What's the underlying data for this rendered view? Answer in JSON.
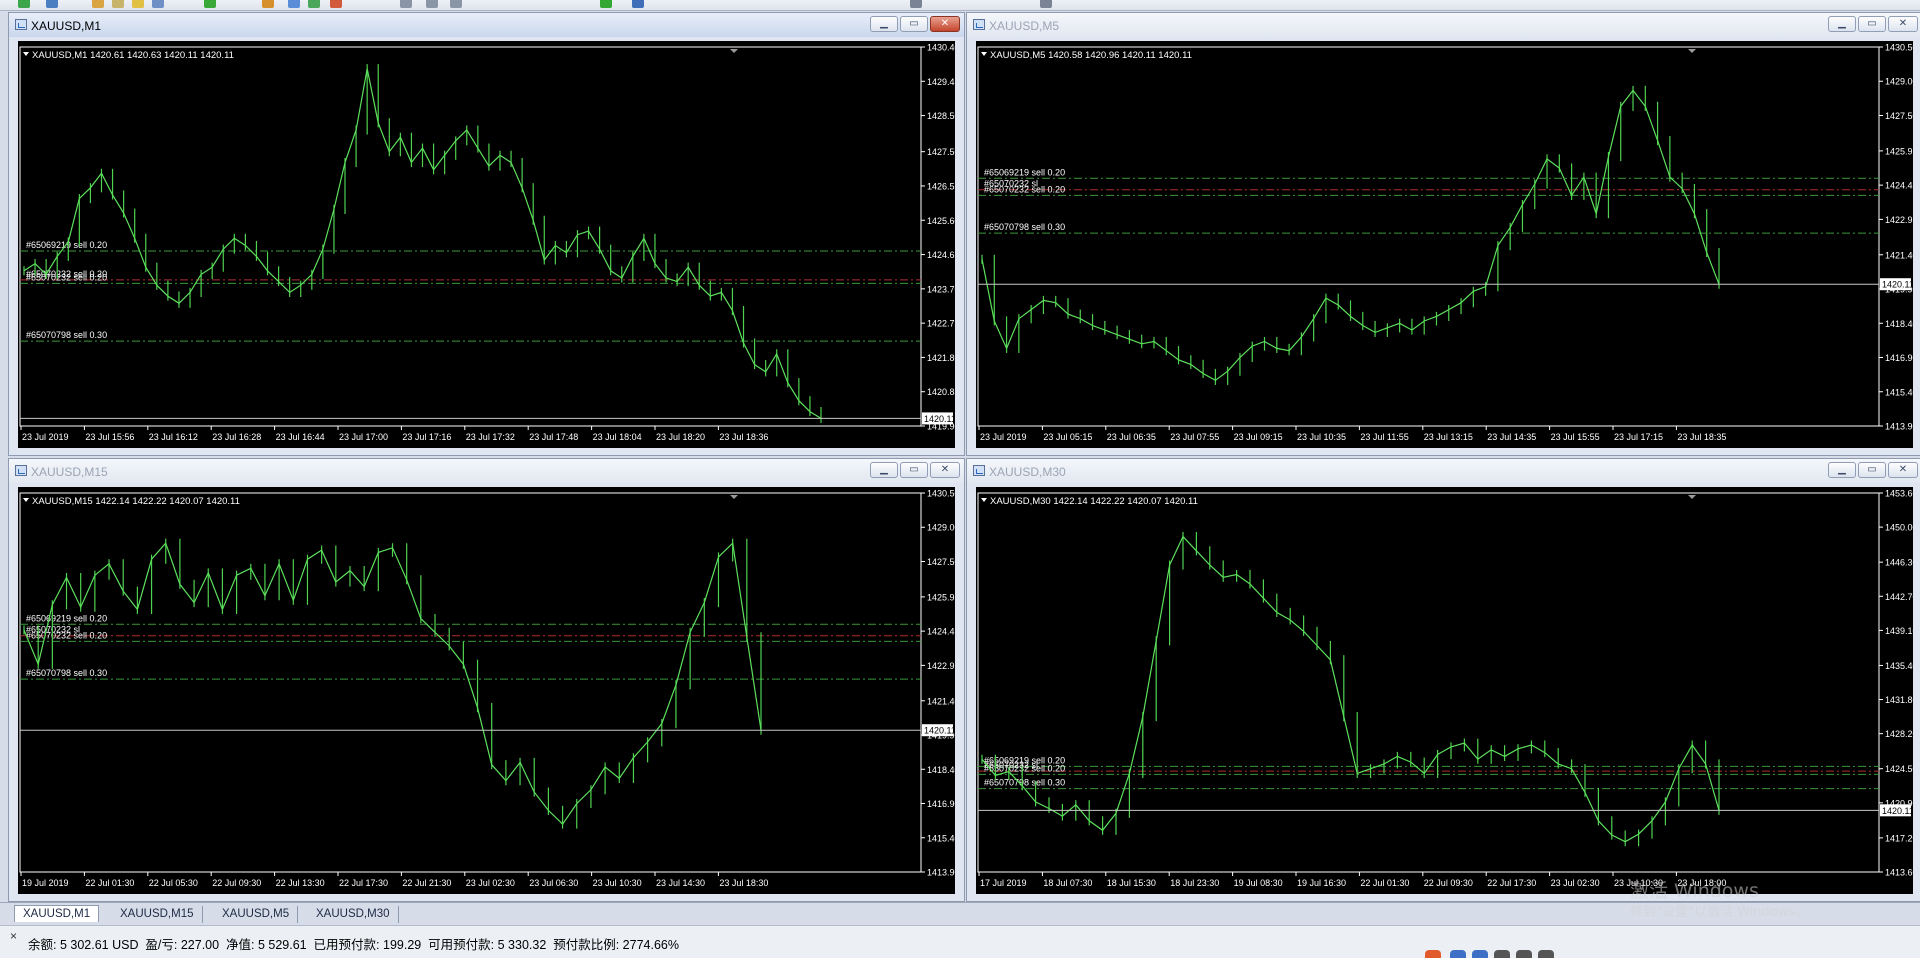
{
  "toolbar": {
    "icons": [
      "new-chart-icon",
      "profiles-icon",
      "refresh-icon",
      "folder-icon",
      "star-icon",
      "market-watch-icon",
      "add-icon",
      "expert-icon",
      "autotrading-icon",
      "bar-chart-icon",
      "candles-icon",
      "line-chart-icon",
      "zoom-in-icon",
      "zoom-out-icon",
      "add-order-icon",
      "globe-icon",
      "crosshair-icon",
      "cursor-icon"
    ]
  },
  "windows": [
    {
      "id": "m1",
      "title": "XAUUSD,M1",
      "info": "XAUUSD,M1  1420.61 1420.63 1420.11 1420.11",
      "active": true,
      "y_range": [
        1419.9,
        1430.4
      ],
      "price_labels": [
        "1430.40",
        "1429.45",
        "1428.50",
        "1427.50",
        "1426.55",
        "1425.60",
        "1424.65",
        "1423.70",
        "1422.75",
        "1421.80",
        "1420.85",
        "1419.90"
      ],
      "current_price": "1420.11",
      "current_price_value": 1420.11,
      "time_labels": [
        "23 Jul 2019",
        "23 Jul 15:56",
        "23 Jul 16:12",
        "23 Jul 16:28",
        "23 Jul 16:44",
        "23 Jul 17:00",
        "23 Jul 17:16",
        "23 Jul 17:32",
        "23 Jul 17:48",
        "23 Jul 18:04",
        "23 Jul 18:20",
        "23 Jul 18:36"
      ],
      "orders": [
        {
          "label": "#65069219 sell 0.20",
          "price": 1424.75,
          "color": "#3a9a3a"
        },
        {
          "label": "#65070232 sell 0.20",
          "price": 1423.95,
          "color": "#b03030"
        },
        {
          "label": "#65070232 sell 0.20",
          "price": 1423.85,
          "color": "#3a9a3a"
        },
        {
          "label": "#65070798 sell 0.30",
          "price": 1422.25,
          "color": "#3a9a3a"
        }
      ],
      "series": [
        1424.2,
        1424.4,
        1424.1,
        1424.6,
        1425.0,
        1426.2,
        1426.5,
        1426.9,
        1426.3,
        1425.8,
        1425.1,
        1424.3,
        1423.8,
        1423.5,
        1423.3,
        1423.6,
        1424.1,
        1424.3,
        1424.8,
        1425.1,
        1424.9,
        1424.6,
        1424.2,
        1423.9,
        1423.6,
        1423.8,
        1424.1,
        1424.8,
        1425.9,
        1427.2,
        1428.1,
        1429.8,
        1428.3,
        1427.5,
        1427.9,
        1427.2,
        1427.6,
        1427.0,
        1427.4,
        1427.8,
        1428.1,
        1427.6,
        1427.1,
        1427.4,
        1427.2,
        1426.5,
        1425.6,
        1424.5,
        1424.9,
        1424.7,
        1425.2,
        1425.3,
        1424.8,
        1424.2,
        1424.0,
        1424.6,
        1425.1,
        1424.4,
        1424.0,
        1423.9,
        1424.3,
        1423.8,
        1423.5,
        1423.6,
        1423.1,
        1422.2,
        1421.6,
        1421.4,
        1421.9,
        1421.1,
        1420.6,
        1420.3,
        1420.11
      ]
    },
    {
      "id": "m5",
      "title": "XAUUSD,M5",
      "info": "XAUUSD,M5  1420.58 1420.96 1420.11 1420.11",
      "active": false,
      "y_range": [
        1413.9,
        1430.5
      ],
      "price_labels": [
        "1430.50",
        "1429.00",
        "1427.50",
        "1425.95",
        "1424.45",
        "1422.95",
        "1421.40",
        "1419.90",
        "1418.40",
        "1416.90",
        "1415.40",
        "1413.90"
      ],
      "current_price": "1420.11",
      "current_price_value": 1420.11,
      "time_labels": [
        "23 Jul 2019",
        "23 Jul 05:15",
        "23 Jul 06:35",
        "23 Jul 07:55",
        "23 Jul 09:15",
        "23 Jul 10:35",
        "23 Jul 11:55",
        "23 Jul 13:15",
        "23 Jul 14:35",
        "23 Jul 15:55",
        "23 Jul 17:15",
        "23 Jul 18:35"
      ],
      "orders": [
        {
          "label": "#65069219 sell 0.20",
          "price": 1424.75,
          "color": "#3a9a3a"
        },
        {
          "label": "#65070232 sl",
          "price": 1424.25,
          "color": "#b03030"
        },
        {
          "label": "#65070232 sell 0.20",
          "price": 1424.0,
          "color": "#3a9a3a"
        },
        {
          "label": "#65070798 sell 0.30",
          "price": 1422.35,
          "color": "#3a9a3a"
        }
      ],
      "series": [
        1421.2,
        1418.5,
        1417.3,
        1418.6,
        1419.0,
        1419.4,
        1419.3,
        1418.8,
        1418.6,
        1418.3,
        1418.1,
        1417.9,
        1417.7,
        1417.5,
        1417.6,
        1417.2,
        1416.8,
        1416.6,
        1416.2,
        1415.9,
        1416.3,
        1416.9,
        1417.4,
        1417.6,
        1417.3,
        1417.2,
        1417.8,
        1418.6,
        1419.5,
        1419.2,
        1418.7,
        1418.3,
        1418.0,
        1418.2,
        1418.4,
        1418.1,
        1418.5,
        1418.7,
        1419.0,
        1419.3,
        1419.8,
        1420.0,
        1421.8,
        1422.6,
        1423.6,
        1424.5,
        1425.6,
        1425.2,
        1424.0,
        1424.8,
        1423.2,
        1425.7,
        1427.9,
        1428.6,
        1427.9,
        1426.4,
        1424.8,
        1424.3,
        1423.2,
        1421.5,
        1420.11
      ]
    },
    {
      "id": "m15",
      "title": "XAUUSD,M15",
      "info": "XAUUSD,M15  1422.14 1422.22 1420.07 1420.11",
      "active": false,
      "y_range": [
        1413.9,
        1430.5
      ],
      "price_labels": [
        "1430.50",
        "1429.00",
        "1427.50",
        "1425.95",
        "1424.45",
        "1422.95",
        "1421.40",
        "1419.90",
        "1418.40",
        "1416.90",
        "1415.40",
        "1413.90"
      ],
      "current_price": "1420.11",
      "current_price_value": 1420.11,
      "time_labels": [
        "19 Jul 2019",
        "22 Jul 01:30",
        "22 Jul 05:30",
        "22 Jul 09:30",
        "22 Jul 13:30",
        "22 Jul 17:30",
        "22 Jul 21:30",
        "23 Jul 02:30",
        "23 Jul 06:30",
        "23 Jul 10:30",
        "23 Jul 14:30",
        "23 Jul 18:30"
      ],
      "orders": [
        {
          "label": "#65069219 sell 0.20",
          "price": 1424.75,
          "color": "#3a9a3a"
        },
        {
          "label": "#65070232 sl",
          "price": 1424.25,
          "color": "#b03030"
        },
        {
          "label": "#65070232 sell 0.20",
          "price": 1424.0,
          "color": "#3a9a3a"
        },
        {
          "label": "#65070798 sell 0.30",
          "price": 1422.35,
          "color": "#3a9a3a"
        }
      ],
      "series": [
        1424.5,
        1423.0,
        1425.6,
        1426.8,
        1425.5,
        1426.9,
        1427.4,
        1426.2,
        1425.4,
        1427.6,
        1428.3,
        1426.5,
        1425.7,
        1427.0,
        1425.4,
        1426.9,
        1427.2,
        1426.0,
        1427.4,
        1425.8,
        1427.6,
        1428.0,
        1426.6,
        1427.1,
        1426.4,
        1427.9,
        1428.1,
        1426.7,
        1425.0,
        1424.4,
        1423.8,
        1423.0,
        1421.1,
        1418.6,
        1417.9,
        1418.7,
        1417.4,
        1416.6,
        1416.0,
        1416.9,
        1417.5,
        1418.5,
        1418.0,
        1418.9,
        1419.6,
        1420.4,
        1422.1,
        1424.4,
        1425.7,
        1427.7,
        1428.3,
        1424.2,
        1420.11
      ]
    },
    {
      "id": "m30",
      "title": "XAUUSD,M30",
      "info": "XAUUSD,M30  1422.14 1422.22 1420.07 1420.11",
      "active": false,
      "y_range": [
        1413.6,
        1453.6
      ],
      "price_labels": [
        "1453.60",
        "1450.00",
        "1446.30",
        "1442.70",
        "1439.10",
        "1435.40",
        "1431.80",
        "1428.20",
        "1424.50",
        "1420.90",
        "1417.20",
        "1413.60"
      ],
      "current_price": "1420.11",
      "current_price_value": 1420.11,
      "time_labels": [
        "17 Jul 2019",
        "18 Jul 07:30",
        "18 Jul 15:30",
        "18 Jul 23:30",
        "19 Jul 08:30",
        "19 Jul 16:30",
        "22 Jul 01:30",
        "22 Jul 09:30",
        "22 Jul 17:30",
        "23 Jul 02:30",
        "23 Jul 10:30",
        "23 Jul 18:00"
      ],
      "orders": [
        {
          "label": "#65069219 sell 0.20",
          "price": 1424.75,
          "color": "#3a9a3a"
        },
        {
          "label": "#65070232 sl",
          "price": 1424.25,
          "color": "#b03030"
        },
        {
          "label": "#65070232 sell 0.20",
          "price": 1423.9,
          "color": "#3a9a3a"
        },
        {
          "label": "#65070798 sell 0.30",
          "price": 1422.4,
          "color": "#3a9a3a"
        }
      ],
      "series": [
        1425.5,
        1423.8,
        1424.2,
        1422.7,
        1421.0,
        1420.3,
        1419.5,
        1420.7,
        1419.0,
        1418.0,
        1419.8,
        1424.0,
        1430.0,
        1438.0,
        1446.0,
        1449.0,
        1447.5,
        1446.0,
        1444.7,
        1445.0,
        1444.0,
        1442.5,
        1441.0,
        1440.2,
        1439.0,
        1437.5,
        1436.0,
        1430.0,
        1424.0,
        1424.5,
        1425.0,
        1425.8,
        1425.2,
        1424.0,
        1426.0,
        1426.8,
        1427.2,
        1425.5,
        1426.5,
        1425.8,
        1426.6,
        1427.0,
        1426.2,
        1425.0,
        1424.5,
        1422.0,
        1419.0,
        1417.5,
        1416.8,
        1417.6,
        1419.0,
        1421.0,
        1424.5,
        1427.0,
        1425.0,
        1420.11
      ]
    }
  ],
  "tabs": [
    {
      "label": "XAUUSD,M1",
      "active": true
    },
    {
      "label": "XAUUSD,M15",
      "active": false
    },
    {
      "label": "XAUUSD,M5",
      "active": false
    },
    {
      "label": "XAUUSD,M30",
      "active": false
    }
  ],
  "status": {
    "close_glyph": "×",
    "text": "余额: 5 302.61 USD  盈/亏: 227.00  净值: 5 529.61  已用预付款: 199.29  可用预付款: 5 330.32  预付款比例: 2774.66%"
  },
  "watermark": {
    "line1": "激活 Windows",
    "line2": "转到\"设置\"以激活 Windows。"
  },
  "colors": {
    "candle": "#4fd24f",
    "background": "#000000",
    "grid_text": "#ffffff",
    "bid_line": "#c8c8c8"
  }
}
